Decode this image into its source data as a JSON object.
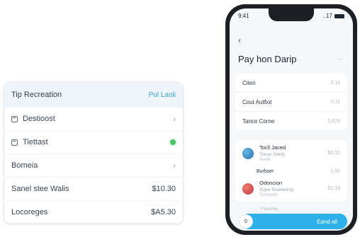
{
  "settings_card": {
    "header": {
      "title": "Tip Recreation",
      "action": "Pol Laoli"
    },
    "rows": [
      {
        "label": "Destioost",
        "icon": "square-icon",
        "trailing": "chevron"
      },
      {
        "label": "Tiettast",
        "icon": "square-icon",
        "trailing": "toggle-dot"
      },
      {
        "label": "Bomeia",
        "trailing": "chevron"
      },
      {
        "label": "Sanel stee Walis",
        "value": "$10.30"
      },
      {
        "label": "Locoreges",
        "value": "$A5.30"
      }
    ],
    "chevron_glyph": "›",
    "accent_color": "#38a3c9",
    "toggle_color": "#4cc26b"
  },
  "phone": {
    "status": {
      "carrier": "9:41",
      "icons": "..17"
    },
    "back_glyph": "‹",
    "title": "Pay hon Darip",
    "more": "···",
    "summary_rows": [
      {
        "label": "Citen",
        "value": "3.14"
      },
      {
        "label": "Cout Autfiot",
        "value": "0.11"
      },
      {
        "label": "Tance Corne",
        "value": "3.624"
      }
    ],
    "items": [
      {
        "title": "Tocll Jaced",
        "subtitle": "Tonse Sdelg",
        "meta": "Saner",
        "amount": "$0.10"
      },
      {
        "title": "Odoncion",
        "subtitle": "Supe Teoelleling",
        "meta": "Tolmeolm",
        "amount": "$1.19"
      }
    ],
    "section": {
      "label": "Burbser",
      "value": "1.00"
    },
    "peek_text": "Fosoctey",
    "cta": {
      "label": "Eand all",
      "circle_label": "0"
    },
    "cta_color": "#2eb0e8"
  }
}
